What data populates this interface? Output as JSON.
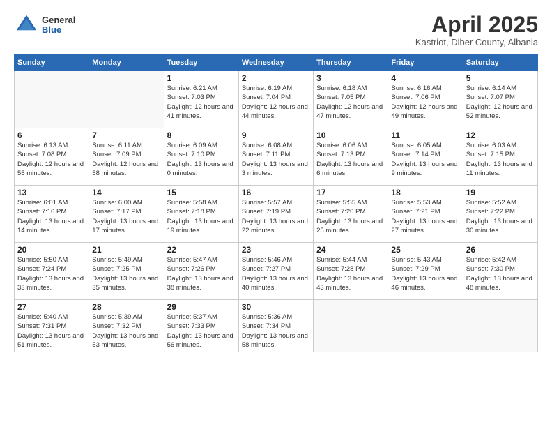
{
  "header": {
    "logo_general": "General",
    "logo_blue": "Blue",
    "month_title": "April 2025",
    "subtitle": "Kastriot, Diber County, Albania"
  },
  "days_of_week": [
    "Sunday",
    "Monday",
    "Tuesday",
    "Wednesday",
    "Thursday",
    "Friday",
    "Saturday"
  ],
  "weeks": [
    [
      {
        "day": "",
        "info": ""
      },
      {
        "day": "",
        "info": ""
      },
      {
        "day": "1",
        "info": "Sunrise: 6:21 AM\nSunset: 7:03 PM\nDaylight: 12 hours and 41 minutes."
      },
      {
        "day": "2",
        "info": "Sunrise: 6:19 AM\nSunset: 7:04 PM\nDaylight: 12 hours and 44 minutes."
      },
      {
        "day": "3",
        "info": "Sunrise: 6:18 AM\nSunset: 7:05 PM\nDaylight: 12 hours and 47 minutes."
      },
      {
        "day": "4",
        "info": "Sunrise: 6:16 AM\nSunset: 7:06 PM\nDaylight: 12 hours and 49 minutes."
      },
      {
        "day": "5",
        "info": "Sunrise: 6:14 AM\nSunset: 7:07 PM\nDaylight: 12 hours and 52 minutes."
      }
    ],
    [
      {
        "day": "6",
        "info": "Sunrise: 6:13 AM\nSunset: 7:08 PM\nDaylight: 12 hours and 55 minutes."
      },
      {
        "day": "7",
        "info": "Sunrise: 6:11 AM\nSunset: 7:09 PM\nDaylight: 12 hours and 58 minutes."
      },
      {
        "day": "8",
        "info": "Sunrise: 6:09 AM\nSunset: 7:10 PM\nDaylight: 13 hours and 0 minutes."
      },
      {
        "day": "9",
        "info": "Sunrise: 6:08 AM\nSunset: 7:11 PM\nDaylight: 13 hours and 3 minutes."
      },
      {
        "day": "10",
        "info": "Sunrise: 6:06 AM\nSunset: 7:13 PM\nDaylight: 13 hours and 6 minutes."
      },
      {
        "day": "11",
        "info": "Sunrise: 6:05 AM\nSunset: 7:14 PM\nDaylight: 13 hours and 9 minutes."
      },
      {
        "day": "12",
        "info": "Sunrise: 6:03 AM\nSunset: 7:15 PM\nDaylight: 13 hours and 11 minutes."
      }
    ],
    [
      {
        "day": "13",
        "info": "Sunrise: 6:01 AM\nSunset: 7:16 PM\nDaylight: 13 hours and 14 minutes."
      },
      {
        "day": "14",
        "info": "Sunrise: 6:00 AM\nSunset: 7:17 PM\nDaylight: 13 hours and 17 minutes."
      },
      {
        "day": "15",
        "info": "Sunrise: 5:58 AM\nSunset: 7:18 PM\nDaylight: 13 hours and 19 minutes."
      },
      {
        "day": "16",
        "info": "Sunrise: 5:57 AM\nSunset: 7:19 PM\nDaylight: 13 hours and 22 minutes."
      },
      {
        "day": "17",
        "info": "Sunrise: 5:55 AM\nSunset: 7:20 PM\nDaylight: 13 hours and 25 minutes."
      },
      {
        "day": "18",
        "info": "Sunrise: 5:53 AM\nSunset: 7:21 PM\nDaylight: 13 hours and 27 minutes."
      },
      {
        "day": "19",
        "info": "Sunrise: 5:52 AM\nSunset: 7:22 PM\nDaylight: 13 hours and 30 minutes."
      }
    ],
    [
      {
        "day": "20",
        "info": "Sunrise: 5:50 AM\nSunset: 7:24 PM\nDaylight: 13 hours and 33 minutes."
      },
      {
        "day": "21",
        "info": "Sunrise: 5:49 AM\nSunset: 7:25 PM\nDaylight: 13 hours and 35 minutes."
      },
      {
        "day": "22",
        "info": "Sunrise: 5:47 AM\nSunset: 7:26 PM\nDaylight: 13 hours and 38 minutes."
      },
      {
        "day": "23",
        "info": "Sunrise: 5:46 AM\nSunset: 7:27 PM\nDaylight: 13 hours and 40 minutes."
      },
      {
        "day": "24",
        "info": "Sunrise: 5:44 AM\nSunset: 7:28 PM\nDaylight: 13 hours and 43 minutes."
      },
      {
        "day": "25",
        "info": "Sunrise: 5:43 AM\nSunset: 7:29 PM\nDaylight: 13 hours and 46 minutes."
      },
      {
        "day": "26",
        "info": "Sunrise: 5:42 AM\nSunset: 7:30 PM\nDaylight: 13 hours and 48 minutes."
      }
    ],
    [
      {
        "day": "27",
        "info": "Sunrise: 5:40 AM\nSunset: 7:31 PM\nDaylight: 13 hours and 51 minutes."
      },
      {
        "day": "28",
        "info": "Sunrise: 5:39 AM\nSunset: 7:32 PM\nDaylight: 13 hours and 53 minutes."
      },
      {
        "day": "29",
        "info": "Sunrise: 5:37 AM\nSunset: 7:33 PM\nDaylight: 13 hours and 56 minutes."
      },
      {
        "day": "30",
        "info": "Sunrise: 5:36 AM\nSunset: 7:34 PM\nDaylight: 13 hours and 58 minutes."
      },
      {
        "day": "",
        "info": ""
      },
      {
        "day": "",
        "info": ""
      },
      {
        "day": "",
        "info": ""
      }
    ]
  ]
}
